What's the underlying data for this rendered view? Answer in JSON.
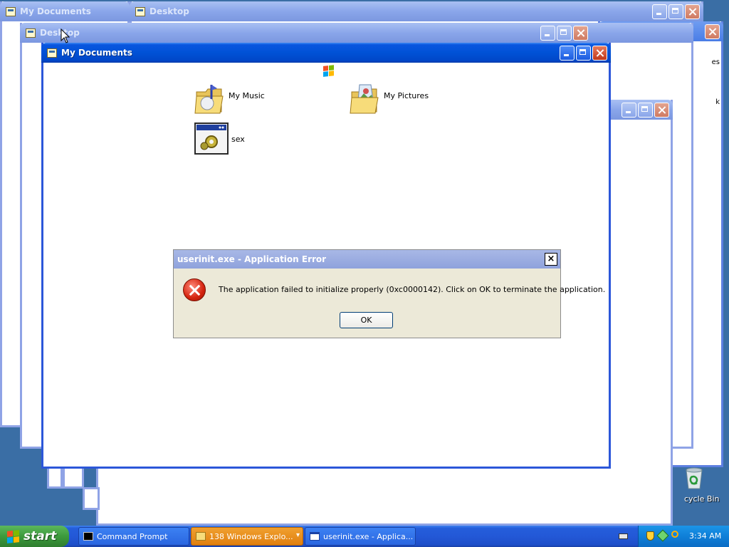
{
  "windows": {
    "back_my_documents": {
      "title": "My Documents"
    },
    "back_desktop_1": {
      "title": "Desktop"
    },
    "back_desktop_2": {
      "title": "Desktop"
    },
    "active_my_documents": {
      "title": "My Documents"
    }
  },
  "folder": {
    "items": [
      {
        "label": "My Music",
        "icon": "music-folder-icon"
      },
      {
        "label": "My Pictures",
        "icon": "pictures-folder-icon"
      },
      {
        "label": "sex",
        "icon": "program-window-icon"
      }
    ]
  },
  "edge_text": {
    "right_fragment_1": "es",
    "right_fragment_2": "k"
  },
  "desktop": {
    "recycle_bin_label": "cycle Bin"
  },
  "dialog": {
    "title": "userinit.exe - Application Error",
    "close_glyph": "×",
    "message": "The application failed to initialize properly (0xc0000142). Click on OK to terminate the application.",
    "ok_label": "OK"
  },
  "taskbar": {
    "start_label": "start",
    "buttons": [
      {
        "label": "Command Prompt"
      },
      {
        "label": "138 Windows Explo...",
        "dropdown_glyph": "▾"
      },
      {
        "label": "userinit.exe - Applica..."
      }
    ],
    "clock": "3:34 AM"
  },
  "colors": {
    "desktop_blue": "#3a6ea5",
    "titlebar_active": "#0052d6",
    "titlebar_inactive": "#8aa6ea",
    "taskbar": "#245edb",
    "start_green": "#3c9a3c",
    "explorer_group": "#e98a12",
    "dialog_face": "#ece9d8"
  }
}
